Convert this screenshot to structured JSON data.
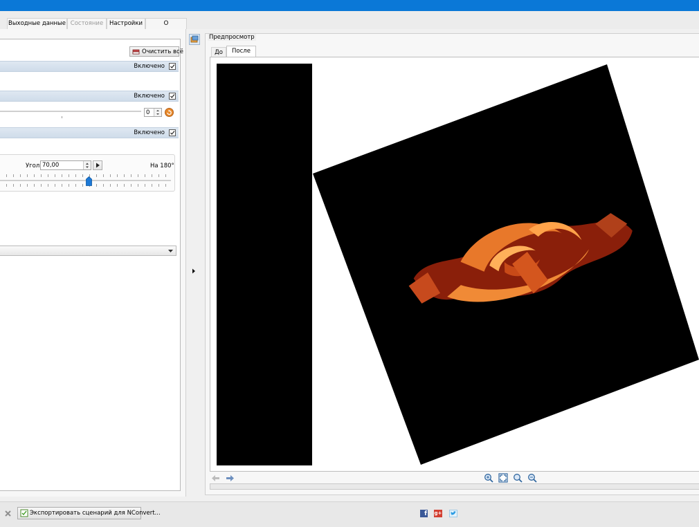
{
  "tabs": [
    {
      "label": "Выходные данные",
      "disabled": false
    },
    {
      "label": "Состояние",
      "disabled": true
    },
    {
      "label": "Настройки",
      "disabled": false
    },
    {
      "label": "О программе",
      "disabled": false
    }
  ],
  "left": {
    "clear_all_label": "Очистить всё",
    "sections": [
      {
        "enabled_label": "Включено",
        "checked": true
      },
      {
        "enabled_label": "Включено",
        "checked": true
      },
      {
        "enabled_label": "Включено",
        "checked": true
      }
    ],
    "spin_value": "0",
    "angle_label": "Угол",
    "angle_value": "70,00",
    "to180_label": "На 180°"
  },
  "preview": {
    "group_label": "Предпросмотр",
    "tabs": [
      {
        "label": "До",
        "active": false
      },
      {
        "label": "После",
        "active": true
      }
    ]
  },
  "bottom": {
    "export_label": "Экспортировать сценарий для NConvert...",
    "social": [
      "facebook-icon",
      "google-plus-icon",
      "twitter-icon"
    ]
  },
  "colors": {
    "titlebar": "#0a78d7",
    "section_bar": "#d6e1ee",
    "accent_orange": "#e8892a"
  }
}
